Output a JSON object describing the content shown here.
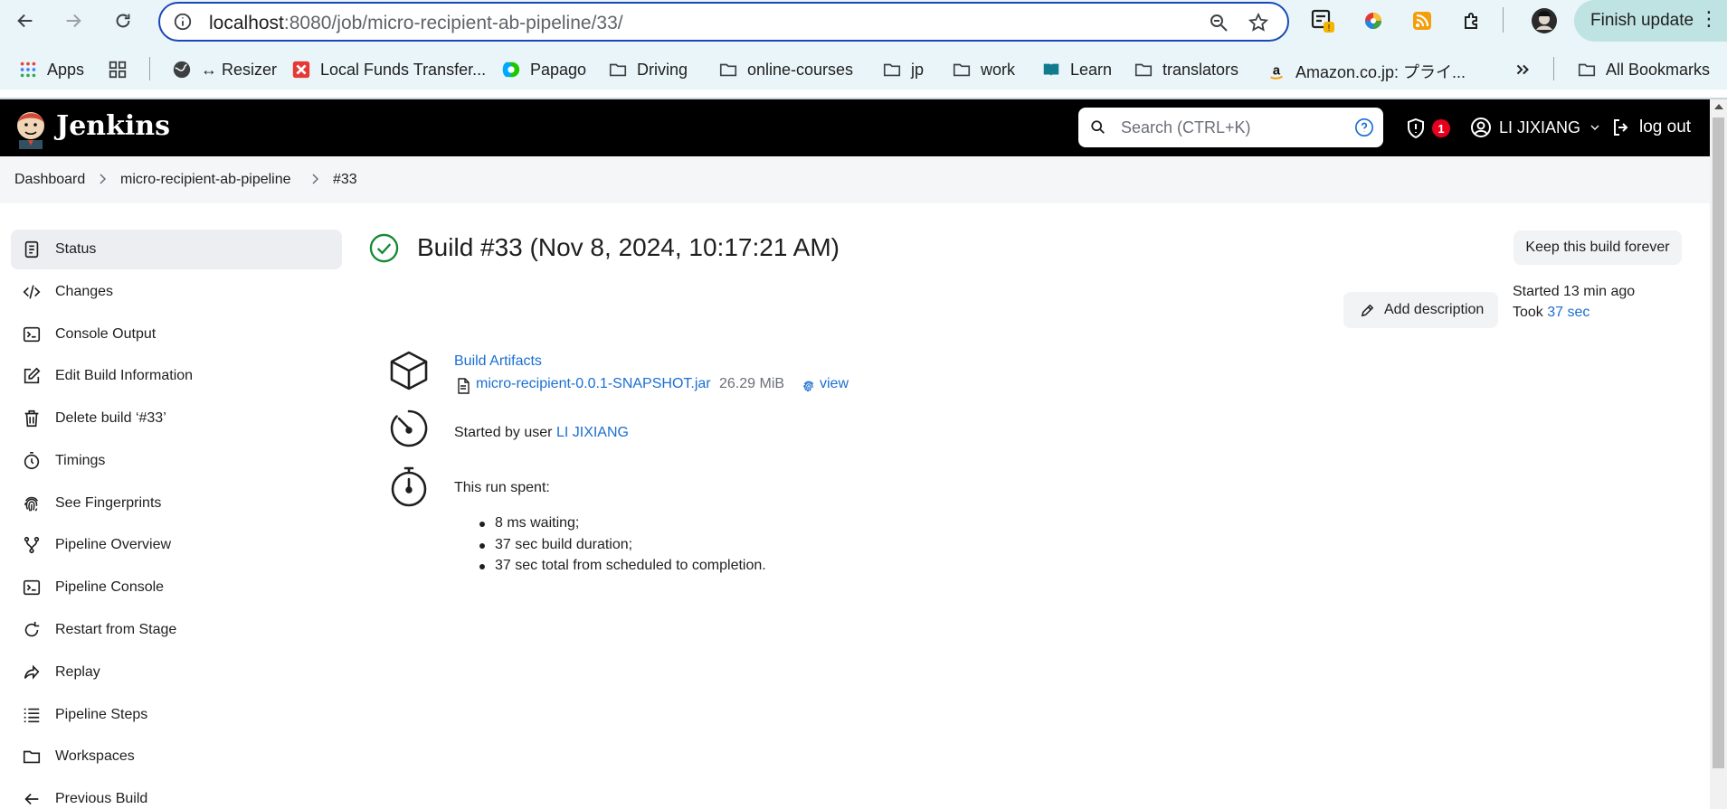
{
  "browser": {
    "url_host": "localhost",
    "url_path": ":8080/job/micro-recipient-ab-pipeline/33/",
    "finish_update_label": "Finish update",
    "bookmarks": [
      {
        "label": "Apps",
        "icon": "apps-grid-icon"
      },
      {
        "label": "",
        "icon": "tab-groups-icon"
      },
      {
        "label": "↔ Resizer",
        "icon": "globe-icon"
      },
      {
        "label": "Local Funds Transfer...",
        "icon": "red-x-icon"
      },
      {
        "label": "Papago",
        "icon": "papago-icon"
      },
      {
        "label": "Driving",
        "icon": "folder-icon"
      },
      {
        "label": "online-courses",
        "icon": "folder-icon"
      },
      {
        "label": "jp",
        "icon": "folder-icon"
      },
      {
        "label": "work",
        "icon": "folder-icon"
      },
      {
        "label": "Learn",
        "icon": "book-icon"
      },
      {
        "label": "translators",
        "icon": "folder-icon"
      },
      {
        "label": "Amazon.co.jp: プライ...",
        "icon": "amazon-icon"
      }
    ],
    "all_bookmarks_label": "All Bookmarks"
  },
  "header": {
    "title": "Jenkins",
    "search_placeholder": "Search (CTRL+K)",
    "security_badge_count": "1",
    "user_name": "LI JIXIANG",
    "logout_label": "log out"
  },
  "breadcrumb": {
    "items": [
      "Dashboard",
      "micro-recipient-ab-pipeline",
      "#33"
    ]
  },
  "sidebar": {
    "items": [
      {
        "label": "Status",
        "icon": "clipboard-icon",
        "active": true
      },
      {
        "label": "Changes",
        "icon": "code-icon"
      },
      {
        "label": "Console Output",
        "icon": "terminal-icon"
      },
      {
        "label": "Edit Build Information",
        "icon": "edit-note-icon"
      },
      {
        "label": "Delete build ‘#33’",
        "icon": "trash-icon"
      },
      {
        "label": "Timings",
        "icon": "stopwatch-icon"
      },
      {
        "label": "See Fingerprints",
        "icon": "fingerprint-icon"
      },
      {
        "label": "Pipeline Overview",
        "icon": "branch-icon"
      },
      {
        "label": "Pipeline Console",
        "icon": "terminal-icon"
      },
      {
        "label": "Restart from Stage",
        "icon": "restart-icon"
      },
      {
        "label": "Replay",
        "icon": "replay-icon"
      },
      {
        "label": "Pipeline Steps",
        "icon": "list-icon"
      },
      {
        "label": "Workspaces",
        "icon": "folder-icon"
      },
      {
        "label": "Previous Build",
        "icon": "arrow-left-icon"
      }
    ]
  },
  "main": {
    "build_title": "Build #33 (Nov 8, 2024, 10:17:21 AM)",
    "keep_forever_label": "Keep this build forever",
    "add_description_label": "Add description",
    "started_ago": "Started 13 min ago",
    "took_prefix": "Took ",
    "took_value": "37 sec",
    "artifacts_title": "Build Artifacts",
    "artifact_file": "micro-recipient-0.0.1-SNAPSHOT.jar",
    "artifact_size": "26.29 MiB",
    "artifact_view": "view",
    "started_by_prefix": "Started by user ",
    "started_by_user": "LI JIXIANG",
    "run_spent_label": "This run spent:",
    "run_spent_items": [
      "8 ms waiting;",
      "37 sec build duration;",
      "37 sec total from scheduled to completion."
    ]
  },
  "colors": {
    "accent_link": "#1a6fd1",
    "success_green": "#138a36",
    "header_bg": "#000000",
    "omnibox_border": "#1a47b8"
  }
}
